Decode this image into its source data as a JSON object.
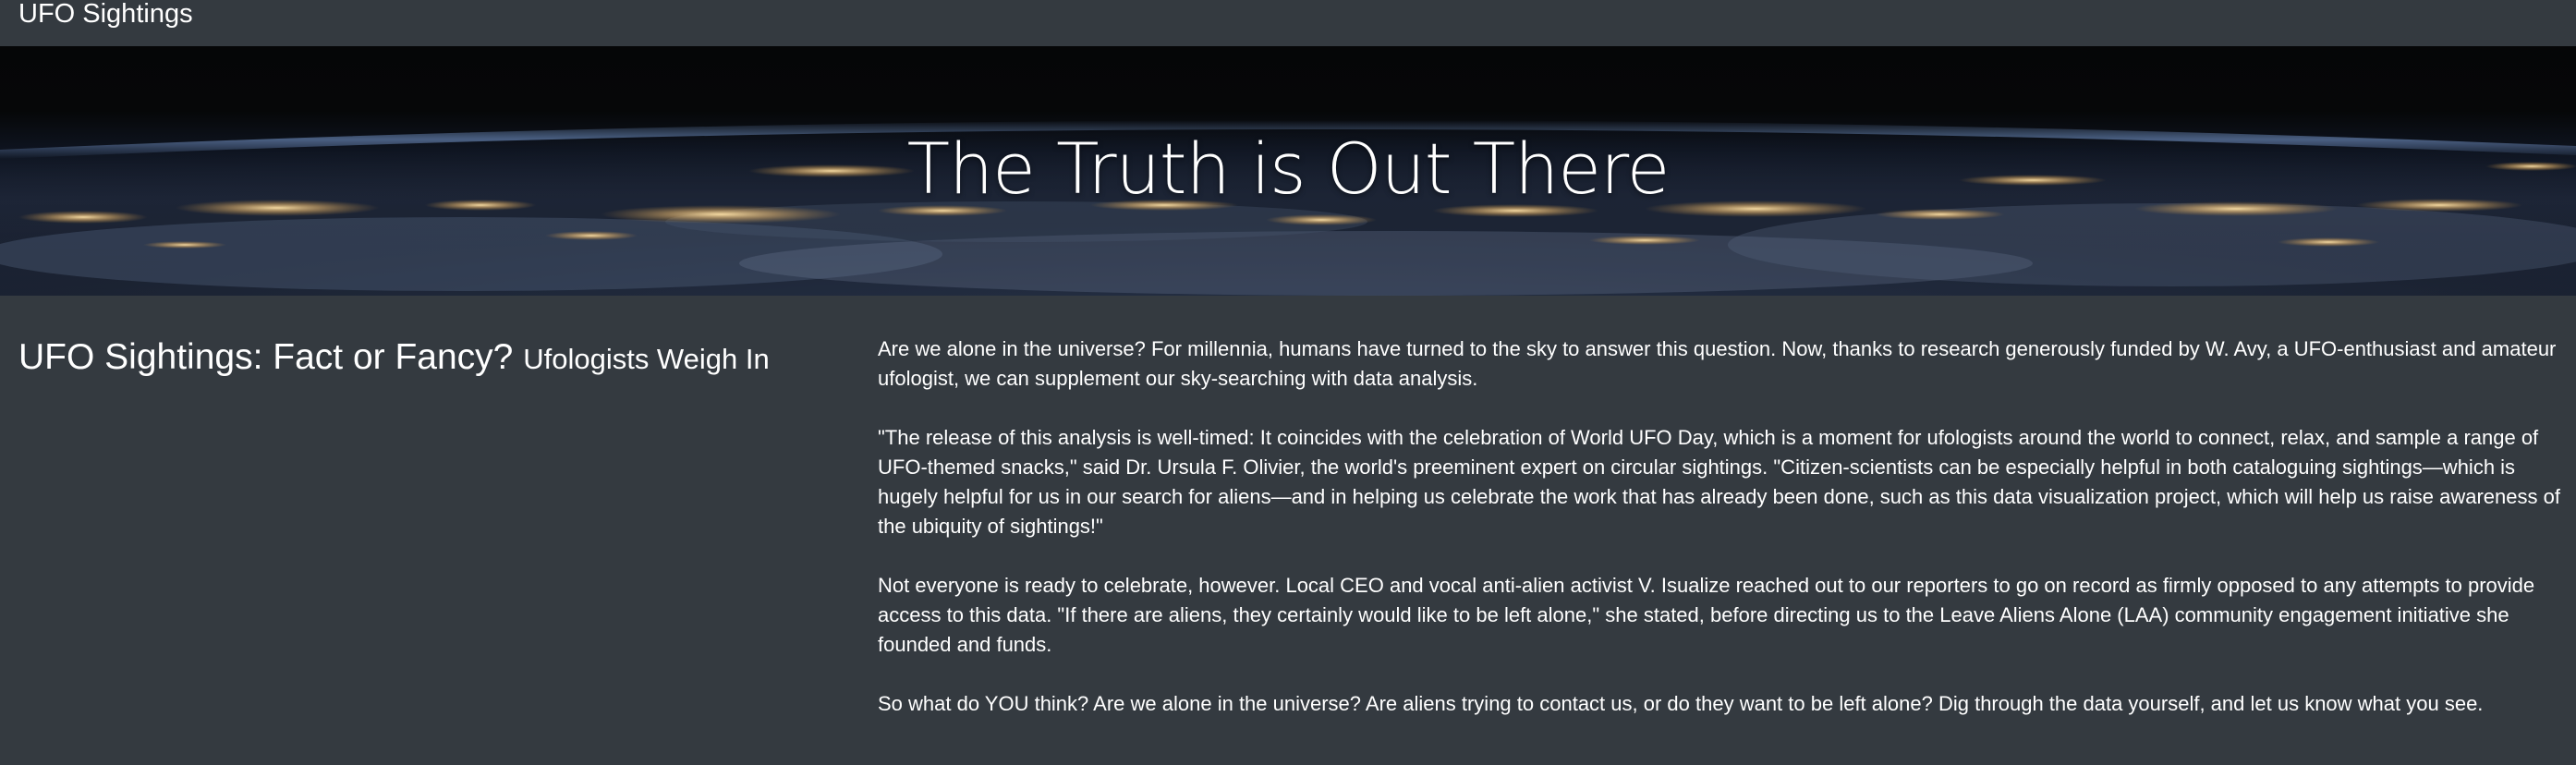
{
  "navbar": {
    "brand": "UFO Sightings"
  },
  "hero": {
    "title": "The Truth is Out There"
  },
  "article": {
    "heading": "UFO Sightings: Fact or Fancy?",
    "subheading": "Ufologists Weigh In",
    "paragraphs": [
      "Are we alone in the universe? For millennia, humans have turned to the sky to answer this question. Now, thanks to research generously funded by W. Avy, a UFO-enthusiast and amateur ufologist, we can supplement our sky-searching with data analysis.",
      "\"The release of this analysis is well-timed: It coincides with the celebration of World UFO Day, which is a moment for ufologists around the world to connect, relax, and sample a range of UFO-themed snacks,\" said Dr. Ursula F. Olivier, the world's preeminent expert on circular sightings. \"Citizen-scientists can be especially helpful in both cataloguing sightings—which is hugely helpful for us in our search for aliens—and in helping us celebrate the work that has already been done, such as this data visualization project, which will help us raise awareness of the ubiquity of sightings!\"",
      "Not everyone is ready to celebrate, however. Local CEO and vocal anti-alien activist V. Isualize reached out to our reporters to go on record as firmly opposed to any attempts to provide access to this data. \"If there are aliens, they certainly would like to be left alone,\" she stated, before directing us to the Leave Aliens Alone (LAA) community engagement initiative she founded and funds.",
      "So what do YOU think? Are we alone in the universe? Are aliens trying to contact us, or do they want to be left alone? Dig through the data yourself, and let us know what you see."
    ]
  }
}
